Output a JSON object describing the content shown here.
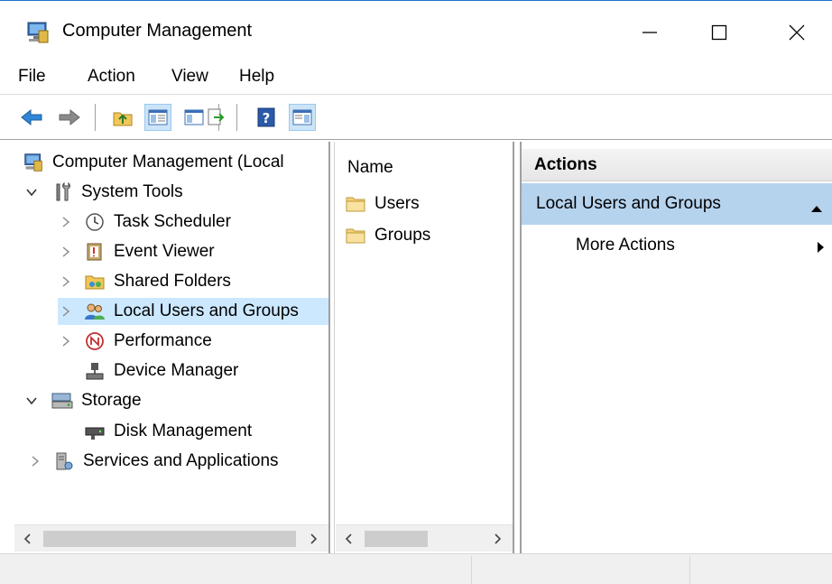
{
  "window": {
    "title": "Computer Management",
    "icon": "computer-management-icon"
  },
  "menu": {
    "items": [
      "File",
      "Action",
      "View",
      "Help"
    ]
  },
  "toolbar": {
    "buttons": [
      "back-arrow-icon",
      "forward-arrow-icon",
      "up-folder-icon",
      "show-hide-console-tree-icon",
      "export-list-icon",
      "help-icon",
      "show-hide-action-pane-icon"
    ]
  },
  "tree": {
    "root": "Computer Management (Local",
    "items": [
      {
        "label": "System Tools",
        "expanded": true
      },
      {
        "label": "Task Scheduler"
      },
      {
        "label": "Event Viewer"
      },
      {
        "label": "Shared Folders"
      },
      {
        "label": "Local Users and Groups",
        "selected": true
      },
      {
        "label": "Performance"
      },
      {
        "label": "Device Manager"
      },
      {
        "label": "Storage",
        "expanded": true
      },
      {
        "label": "Disk Management"
      },
      {
        "label": "Services and Applications"
      }
    ]
  },
  "list": {
    "header": "Name",
    "rows": [
      "Users",
      "Groups"
    ]
  },
  "actions": {
    "header": "Actions",
    "section": "Local Users and Groups",
    "items": [
      "More Actions"
    ]
  },
  "colors": {
    "accent_border": "#1e74c8",
    "selection": "#cce8ff",
    "action_section": "#b6d3ee"
  }
}
